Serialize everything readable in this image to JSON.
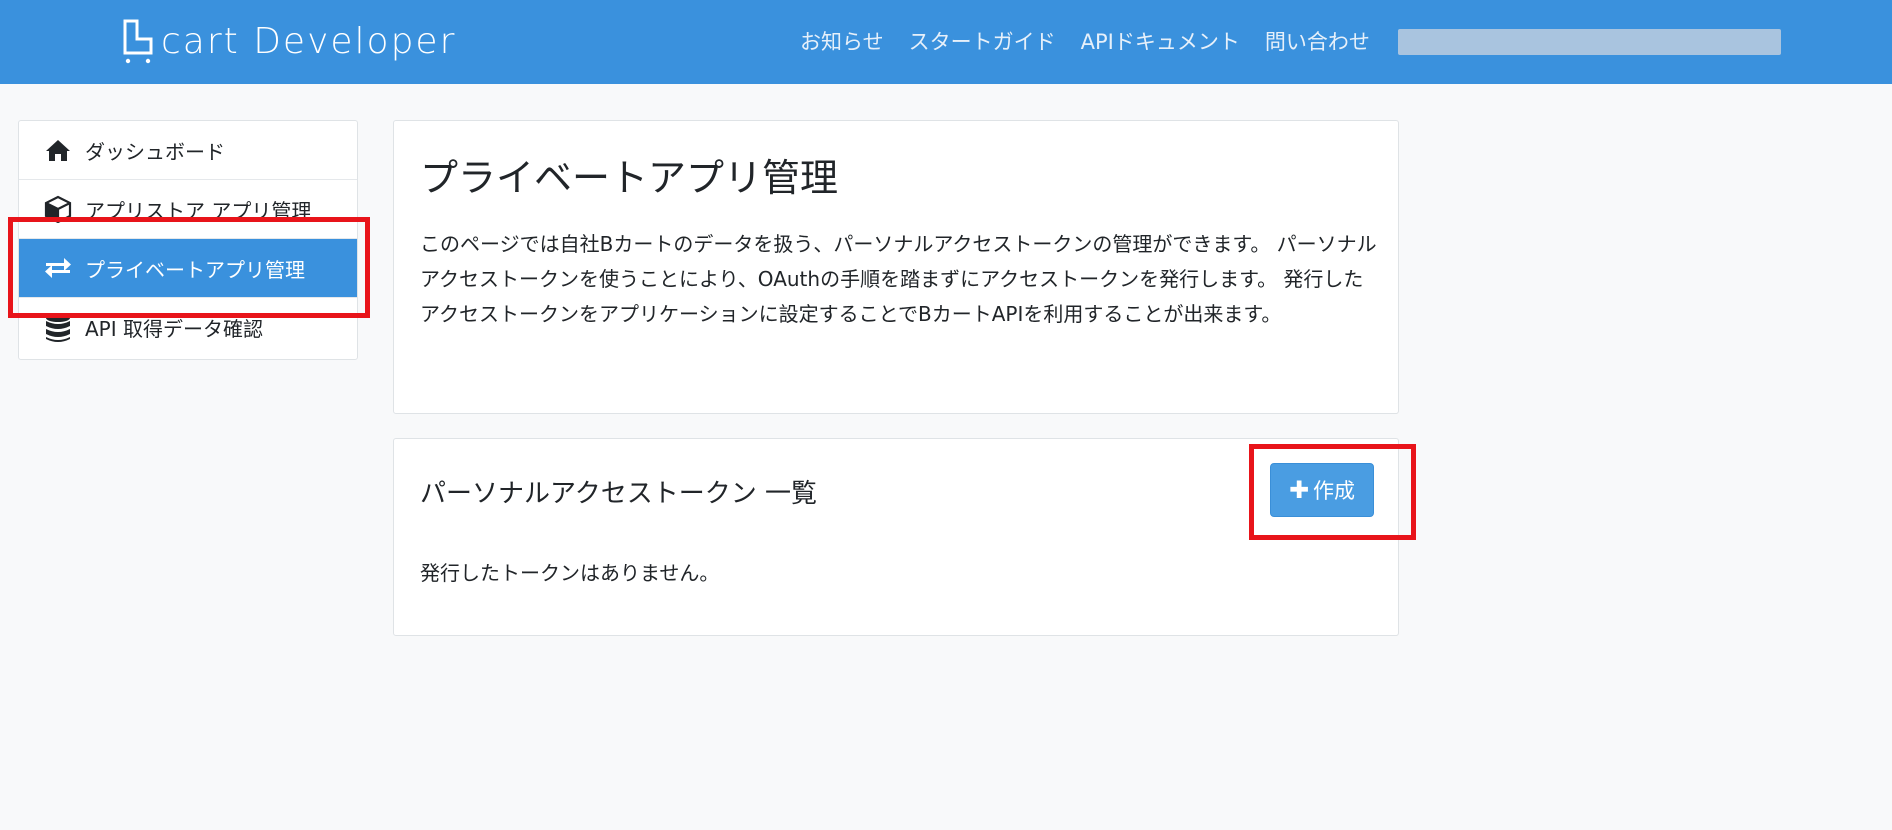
{
  "brand": {
    "name": "cart Developer"
  },
  "nav": {
    "links": [
      {
        "label": "お知らせ"
      },
      {
        "label": "スタートガイド"
      },
      {
        "label": "APIドキュメント"
      },
      {
        "label": "問い合わせ"
      }
    ]
  },
  "sidebar": {
    "items": [
      {
        "label": "ダッシュボード",
        "icon": "home-icon"
      },
      {
        "label": "アプリストア アプリ管理",
        "icon": "box-icon"
      },
      {
        "label": "プライベートアプリ管理",
        "icon": "exchange-icon",
        "active": true
      },
      {
        "label": "API 取得データ確認",
        "icon": "database-icon"
      }
    ]
  },
  "main": {
    "title": "プライベートアプリ管理",
    "description": "このページでは自社Bカートのデータを扱う、パーソナルアクセストークンの管理ができます。 パーソナルアクセストークンを使うことにより、OAuthの手順を踏まずにアクセストークンを発行します。 発行したアクセストークンをアプリケーションに設定することでBカートAPIを利用することが出来ます。",
    "token_section": {
      "title": "パーソナルアクセストークン 一覧",
      "create_label": "作成",
      "empty_text": "発行したトークンはありません。"
    }
  },
  "colors": {
    "navbar": "#3a91dd",
    "active": "#3a91dd",
    "button": "#4a9de2",
    "highlight": "#e8141a"
  }
}
